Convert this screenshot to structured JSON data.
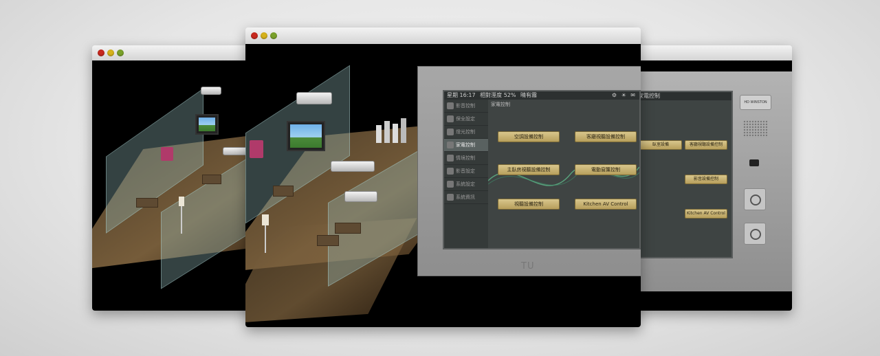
{
  "windows": {
    "left": {
      "name": "browser-window-left"
    },
    "center": {
      "name": "browser-window-center"
    },
    "right": {
      "name": "browser-window-right"
    }
  },
  "panel": {
    "status": {
      "time": "星期 16:17",
      "humidity": "相對溼度 52%",
      "weather": "晴有霧"
    },
    "section_title": "家電控制",
    "sidebar_items": [
      {
        "label": "影音控制",
        "icon": "media-icon",
        "active": false
      },
      {
        "label": "保全設定",
        "icon": "lock-icon",
        "active": false
      },
      {
        "label": "燈光控制",
        "icon": "bulb-icon",
        "active": false
      },
      {
        "label": "家電控制",
        "icon": "appliance-icon",
        "active": true
      },
      {
        "label": "情境控制",
        "icon": "scene-icon",
        "active": false
      },
      {
        "label": "影音設定",
        "icon": "settings-icon",
        "active": false
      },
      {
        "label": "系統設定",
        "icon": "system-icon",
        "active": false
      },
      {
        "label": "系統資訊",
        "icon": "info-icon",
        "active": false
      }
    ],
    "buttons": [
      {
        "label": "空調設備控制",
        "icon": "ac-icon"
      },
      {
        "label": "客廳視聽設備控制",
        "icon": "tv-icon"
      },
      {
        "label": "主臥房視聽設備控制",
        "icon": "bed-icon"
      },
      {
        "label": "電動窗簾控制",
        "icon": "curtain-icon"
      },
      {
        "label": "視聽設備控制",
        "icon": "speaker-icon"
      },
      {
        "label": "Kitchen AV Control",
        "icon": "kitchen-icon"
      }
    ],
    "logo": "TU"
  },
  "device": {
    "buttons": [
      "臥室設備",
      "客廳視聽設備控制",
      "影音設備控制",
      "Kitchen AV Control"
    ],
    "brand": "HD WINSTON",
    "status_title": "家電控制"
  },
  "colors": {
    "button_gold": "#c9b46f",
    "screen_dark": "#3f4443",
    "frame_gray": "#9a9a9a"
  }
}
